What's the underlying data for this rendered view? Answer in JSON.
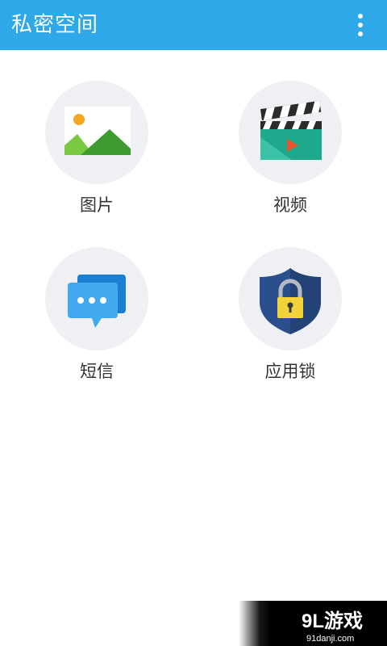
{
  "appbar": {
    "title": "私密空间",
    "color": "#2fa8ea",
    "menu_icon": "more-vertical-icon"
  },
  "grid": {
    "items": [
      {
        "label": "图片",
        "icon": "image-icon"
      },
      {
        "label": "视频",
        "icon": "clapperboard-icon"
      },
      {
        "label": "短信",
        "icon": "chat-bubbles-icon"
      },
      {
        "label": "应用锁",
        "icon": "shield-lock-icon"
      }
    ]
  },
  "watermark": {
    "brand": "9L游戏",
    "url": "91danji.com"
  }
}
